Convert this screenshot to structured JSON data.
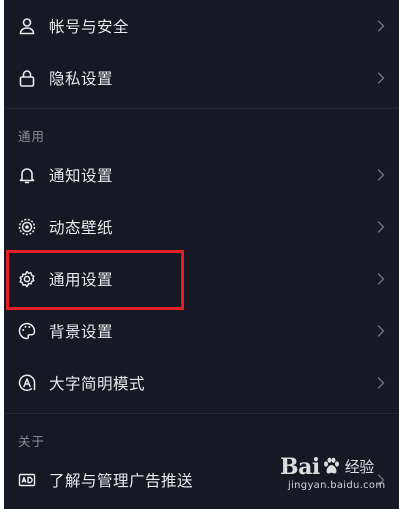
{
  "sections": {
    "account_items": [
      {
        "label": "帐号与安全",
        "icon": "person-icon"
      },
      {
        "label": "隐私设置",
        "icon": "lock-icon"
      }
    ],
    "general_header": "通用",
    "general_items": [
      {
        "label": "通知设置",
        "icon": "bell-icon"
      },
      {
        "label": "动态壁纸",
        "icon": "live-wallpaper-icon"
      },
      {
        "label": "通用设置",
        "icon": "gear-icon"
      },
      {
        "label": "背景设置",
        "icon": "palette-icon"
      },
      {
        "label": "大字简明模式",
        "icon": "large-text-icon"
      }
    ],
    "about_header": "关于",
    "about_items": [
      {
        "label": "了解与管理广告推送",
        "icon": "ad-icon"
      }
    ]
  },
  "watermark": {
    "brand_left": "Bai",
    "brand_right": "经验",
    "url": "jingyan.baidu.com"
  },
  "colors": {
    "background": "#161823",
    "text": "#e9e9ec",
    "section_header": "#8a8b93",
    "highlight_box": "#e0212b"
  }
}
